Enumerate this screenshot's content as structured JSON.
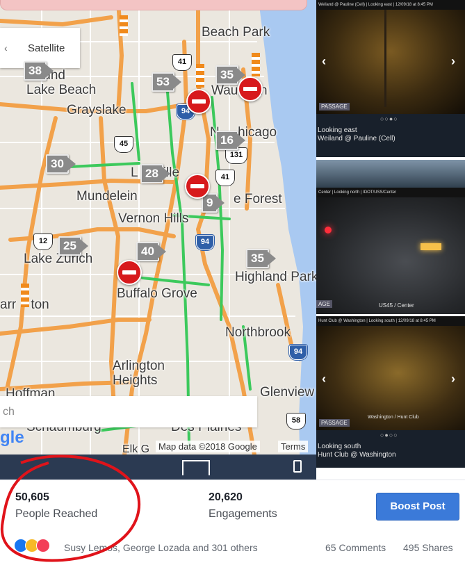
{
  "map": {
    "satellite_label": "Satellite",
    "places": {
      "beach_park": "Beach Park",
      "round_lake_beach": "Round\nLake Beach",
      "waukegan": "Wau  gan",
      "grayslake": "Grayslake",
      "north_chicago": "N     hicago",
      "libertyville": "L       ille",
      "mundelein": "Mundelein",
      "lake_forest": "e Forest",
      "vernon_hills": "Vernon Hills",
      "lake_zurich": "Lake Zurich",
      "highland_park": "Highland Park",
      "buffalo_grove": "Buffalo Grove",
      "barrington": "arr    ton",
      "northbrook": "Northbrook",
      "arlington_heights": "Arlington\nHeights",
      "hoffman": "Hoffman",
      "glenview": "Glenview",
      "schaumburg": "Schaumburg",
      "des_plaines": "Des Plaines",
      "elk_grove": "Elk G"
    },
    "highways": {
      "us41_top": "41",
      "i94_top": "94",
      "us45": "45",
      "r131": "131",
      "us41_mid": "41",
      "us12": "12",
      "i94_mid": "94",
      "i94_bottom": "94",
      "r58": "58"
    },
    "cameras": {
      "c38": "38",
      "c53": "53",
      "c35_top": "35",
      "c16": "16",
      "c30": "30",
      "c28": "28",
      "c9": "9",
      "c25": "25",
      "c40": "40",
      "c35_bottom": "35"
    },
    "search_partial": "ch",
    "google_logo_partial": "gle",
    "attribution": "Map data ©2018 Google",
    "terms": "Terms"
  },
  "camera_feeds": [
    {
      "header": "Weiland @ Pauline (Cell) | Looking east | 12/09/18 at 8:45 PM",
      "caption_line1": "Looking  east",
      "caption_line2": "Weiland @ Pauline (Cell)",
      "logo": "PASSAGE",
      "dots": "○○●○"
    },
    {
      "header": "Center | Looking north | IDOT/USS/Center",
      "caption_line1": "US45 / Center",
      "caption_line2": "",
      "logo": "AGE",
      "dots": ""
    },
    {
      "header": "Hunt Club @ Washington | Looking south | 12/09/18 at 8:45 PM",
      "caption_line1": "Looking  south",
      "caption_line2": "Hunt Club @ Washington",
      "logo": "PASSAGE",
      "dots": "○●○○",
      "overlay_text": "Washington / Hunt Club"
    }
  ],
  "stats": {
    "reached_value": "50,605",
    "reached_label": "People Reached",
    "engagements_value": "20,620",
    "engagements_label": "Engagements",
    "boost_label": "Boost Post"
  },
  "reactions": {
    "names": "Susy Lemos, George Lozada and 301 others",
    "comments": "65 Comments",
    "shares": "495 Shares"
  },
  "colors": {
    "highway_orange": "#f2a14a",
    "traffic_green": "#3cc95c",
    "water": "#a7c8f2",
    "closure_red": "#d7191c",
    "boost_blue": "#3b7ad9",
    "annotation_red": "#e0131a"
  }
}
